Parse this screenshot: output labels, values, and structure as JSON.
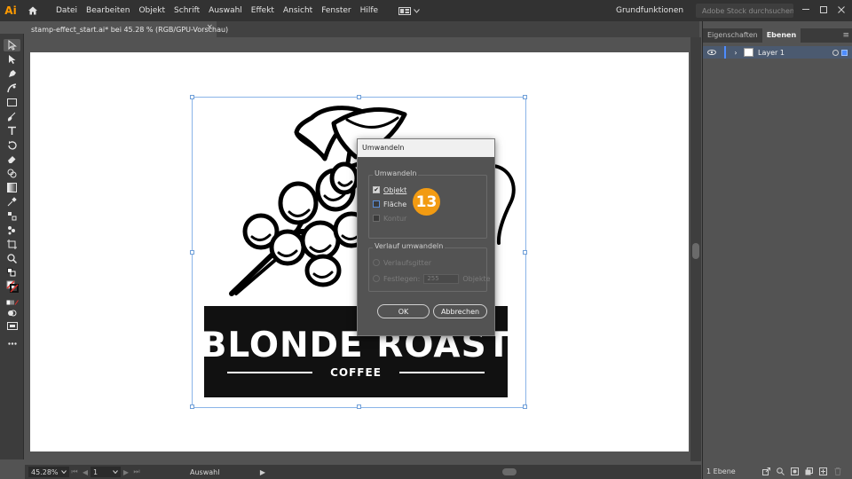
{
  "app": {
    "logo": "Ai",
    "accent": "#ff9a00"
  },
  "menu": [
    "Datei",
    "Bearbeiten",
    "Objekt",
    "Schrift",
    "Auswahl",
    "Effekt",
    "Ansicht",
    "Fenster",
    "Hilfe"
  ],
  "workspace": {
    "label": "Grundfunktionen"
  },
  "search": {
    "placeholder": "Adobe Stock durchsuchen"
  },
  "document": {
    "tab_title": "stamp-effect_start.ai* bei 45.28 % (RGB/GPU-Vorschau)",
    "close_glyph": "×"
  },
  "artwork": {
    "headline": "BLONDE ROAST",
    "subline": "COFFEE"
  },
  "dialog": {
    "title": "Umwandeln",
    "group1_title": "Umwandeln",
    "opt_objekt": "Objekt",
    "opt_flaeche": "Fläche",
    "opt_kontur": "Kontur",
    "group2_title": "Verlauf umwandeln",
    "opt_verlaufsgitter": "Verlaufsgitter",
    "opt_festlegen": "Festlegen:",
    "festlegen_value": "255",
    "objekte_label": "Objekte",
    "ok_label": "OK",
    "cancel_label": "Abbrechen",
    "objekt_checked": true,
    "flaeche_checked": false
  },
  "step_badge": "13",
  "status": {
    "zoom": "45.28%",
    "page": "1",
    "mode": "Auswahl"
  },
  "panel": {
    "tabs": [
      "Eigenschaften",
      "Ebenen"
    ],
    "active_tab": "Ebenen",
    "layers": [
      {
        "name": "Layer 1"
      }
    ],
    "footer_count": "1 Ebene"
  }
}
